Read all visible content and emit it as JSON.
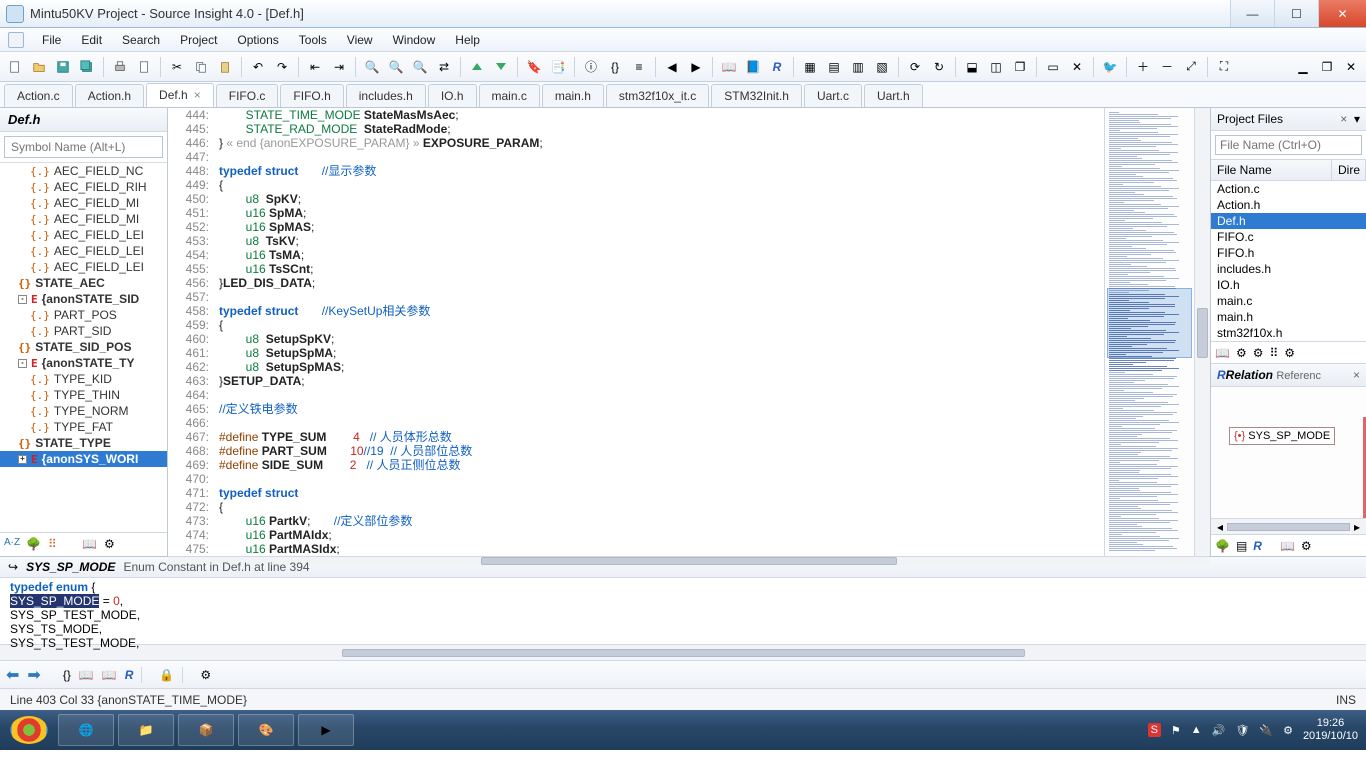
{
  "title": "Mintu50KV Project - Source Insight 4.0 - [Def.h]",
  "menu": [
    "File",
    "Edit",
    "Search",
    "Project",
    "Options",
    "Tools",
    "View",
    "Window",
    "Help"
  ],
  "tabs": [
    "Action.c",
    "Action.h",
    "Def.h",
    "FIFO.c",
    "FIFO.h",
    "includes.h",
    "IO.h",
    "main.c",
    "main.h",
    "stm32f10x_it.c",
    "STM32Init.h",
    "Uart.c",
    "Uart.h"
  ],
  "tabs_active": "Def.h",
  "left": {
    "header": "Def.h",
    "placeholder": "Symbol Name (Alt+L)",
    "items": [
      {
        "t": "AEC_FIELD_NC",
        "g": "{.}",
        "l": 2
      },
      {
        "t": "AEC_FIELD_RIH",
        "g": "{.}",
        "l": 2
      },
      {
        "t": "AEC_FIELD_MI",
        "g": "{.}",
        "l": 2
      },
      {
        "t": "AEC_FIELD_MI",
        "g": "{.}",
        "l": 2
      },
      {
        "t": "AEC_FIELD_LEI",
        "g": "{.}",
        "l": 2
      },
      {
        "t": "AEC_FIELD_LEI",
        "g": "{.}",
        "l": 2
      },
      {
        "t": "AEC_FIELD_LEI",
        "g": "{.}",
        "l": 2
      },
      {
        "t": "STATE_AEC",
        "g": "{}",
        "l": 1,
        "bold": true
      },
      {
        "t": "{anonSTATE_SID",
        "g": "E",
        "l": 1,
        "bold": true,
        "exp": "-"
      },
      {
        "t": "PART_POS",
        "g": "{.}",
        "l": 2
      },
      {
        "t": "PART_SID",
        "g": "{.}",
        "l": 2
      },
      {
        "t": "STATE_SID_POS",
        "g": "{}",
        "l": 1,
        "bold": true
      },
      {
        "t": "{anonSTATE_TY",
        "g": "E",
        "l": 1,
        "bold": true,
        "exp": "-"
      },
      {
        "t": "TYPE_KID",
        "g": "{.}",
        "l": 2
      },
      {
        "t": "TYPE_THIN",
        "g": "{.}",
        "l": 2
      },
      {
        "t": "TYPE_NORM",
        "g": "{.}",
        "l": 2
      },
      {
        "t": "TYPE_FAT",
        "g": "{.}",
        "l": 2
      },
      {
        "t": "STATE_TYPE",
        "g": "{}",
        "l": 1,
        "bold": true
      },
      {
        "t": "{anonSYS_WORI",
        "g": "E",
        "l": 1,
        "bold": true,
        "exp": "+",
        "sel": true
      }
    ]
  },
  "code": {
    "start": 444,
    "lines": [
      {
        "h": "        <span class='ty'>STATE_TIME_MODE</span> <span class='bold'>StateMasMsAec</span>;"
      },
      {
        "h": "        <span class='ty'>STATE_RAD_MODE</span>  <span class='bold'>StateRadMode</span>;"
      },
      {
        "h": "} <span style='color:#999'>« end {anonEXPOSURE_PARAM} »</span> <span class='bold'>EXPOSURE_PARAM</span>;"
      },
      {
        "h": ""
      },
      {
        "h": "<span class='kw'>typedef</span> <span class='kw'>struct</span>       <span class='cm'>//显示参数</span>"
      },
      {
        "h": "{"
      },
      {
        "h": "        <span class='ty'>u8</span>  <span class='bold'>SpKV</span>;"
      },
      {
        "h": "        <span class='ty'>u16</span> <span class='bold'>SpMA</span>;"
      },
      {
        "h": "        <span class='ty'>u16</span> <span class='bold'>SpMAS</span>;"
      },
      {
        "h": "        <span class='ty'>u8</span>  <span class='bold'>TsKV</span>;"
      },
      {
        "h": "        <span class='ty'>u16</span> <span class='bold'>TsMA</span>;"
      },
      {
        "h": "        <span class='ty'>u16</span> <span class='bold'>TsSCnt</span>;"
      },
      {
        "h": "}<span class='bold'>LED_DIS_DATA</span>;"
      },
      {
        "h": ""
      },
      {
        "h": "<span class='kw'>typedef</span> <span class='kw'>struct</span>       <span class='cm'>//KeySetUp相关参数</span>"
      },
      {
        "h": "{"
      },
      {
        "h": "        <span class='ty'>u8</span>  <span class='bold'>SetupSpKV</span>;"
      },
      {
        "h": "        <span class='ty'>u8</span>  <span class='bold'>SetupSpMA</span>;"
      },
      {
        "h": "        <span class='ty'>u8</span>  <span class='bold'>SetupSpMAS</span>;"
      },
      {
        "h": "}<span class='bold'>SETUP_DATA</span>;"
      },
      {
        "h": ""
      },
      {
        "h": "<span class='cm'>//定义铁电参数</span>"
      },
      {
        "h": ""
      },
      {
        "h": "<span class='pp'>#define</span> <span class='bold'>TYPE_SUM</span>        <span class='num'>4</span>   <span class='cm'>// 人员体形总数</span>"
      },
      {
        "h": "<span class='pp'>#define</span> <span class='bold'>PART_SUM</span>       <span class='num'>10</span><span class='cm'>//19  // 人员部位总数</span>"
      },
      {
        "h": "<span class='pp'>#define</span> <span class='bold'>SIDE_SUM</span>        <span class='num'>2</span>   <span class='cm'>// 人员正侧位总数</span>"
      },
      {
        "h": ""
      },
      {
        "h": "<span class='kw'>typedef</span> <span class='kw'>struct</span>"
      },
      {
        "h": "{"
      },
      {
        "h": "        <span class='ty'>u16</span> <span class='bold'>PartkV</span>;       <span class='cm'>//定义部位参数</span>"
      },
      {
        "h": "        <span class='ty'>u16</span> <span class='bold'>PartMAIdx</span>;"
      },
      {
        "h": "        <span class='ty'>u16</span> <span class='bold'>PartMASIdx</span>;"
      }
    ]
  },
  "project_files": {
    "title": "Project Files",
    "placeholder": "File Name (Ctrl+O)",
    "cols": [
      "File Name",
      "Dire"
    ],
    "rows": [
      "Action.c",
      "Action.h",
      "Def.h",
      "FIFO.c",
      "FIFO.h",
      "includes.h",
      "IO.h",
      "main.c",
      "main.h",
      "stm32f10x.h"
    ],
    "sel": "Def.h"
  },
  "relation": {
    "title": "Relation",
    "sub": "Referenc",
    "node": "SYS_SP_MODE"
  },
  "context": {
    "sig": "SYS_SP_MODE",
    "desc": "Enum Constant in Def.h at line 394",
    "body": [
      "<span class='kw'>typedef</span>  <span class='kw'>enum</span> {",
      "     <span class='hl'>SYS_SP_MODE</span> = <span class='num'>0</span>,",
      "     SYS_SP_TEST_MODE,",
      "     SYS_TS_MODE,",
      "     SYS_TS_TEST_MODE,"
    ]
  },
  "status": {
    "left": "Line 403   Col 33   {anonSTATE_TIME_MODE}",
    "right": "INS"
  },
  "tray": {
    "time": "19:26",
    "date": "2019/10/10"
  }
}
